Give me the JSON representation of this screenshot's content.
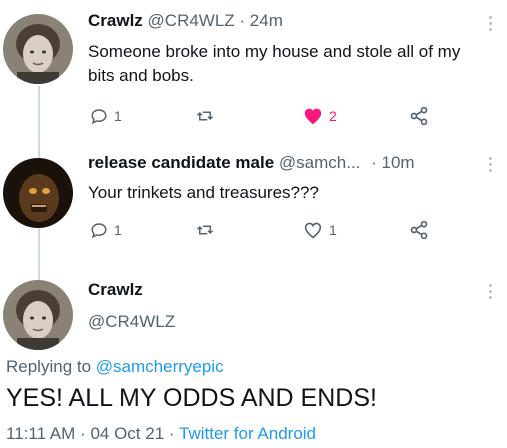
{
  "tweets": [
    {
      "name": "Crawlz",
      "handle": "@CR4WLZ",
      "time": "· 24m",
      "text": "Someone broke into my house and stole all of my bits and bobs.",
      "replies": "1",
      "likes": "2",
      "liked": true
    },
    {
      "name": "release candidate male",
      "handle": "@samch...",
      "time": "· 10m",
      "text": "Your trinkets and treasures???",
      "replies": "1",
      "likes": "1",
      "liked": false
    }
  ],
  "focused": {
    "name": "Crawlz",
    "handle": "@CR4WLZ",
    "replying_prefix": "Replying to ",
    "replying_to": "@samcherryepic",
    "text": "YES! ALL MY ODDS AND ENDS!",
    "time": "11:11 AM",
    "date": "04 Oct 21",
    "source": "Twitter for Android"
  },
  "colors": {
    "like_active": "#f91880",
    "link": "#1d9bf0",
    "muted": "#536471"
  }
}
